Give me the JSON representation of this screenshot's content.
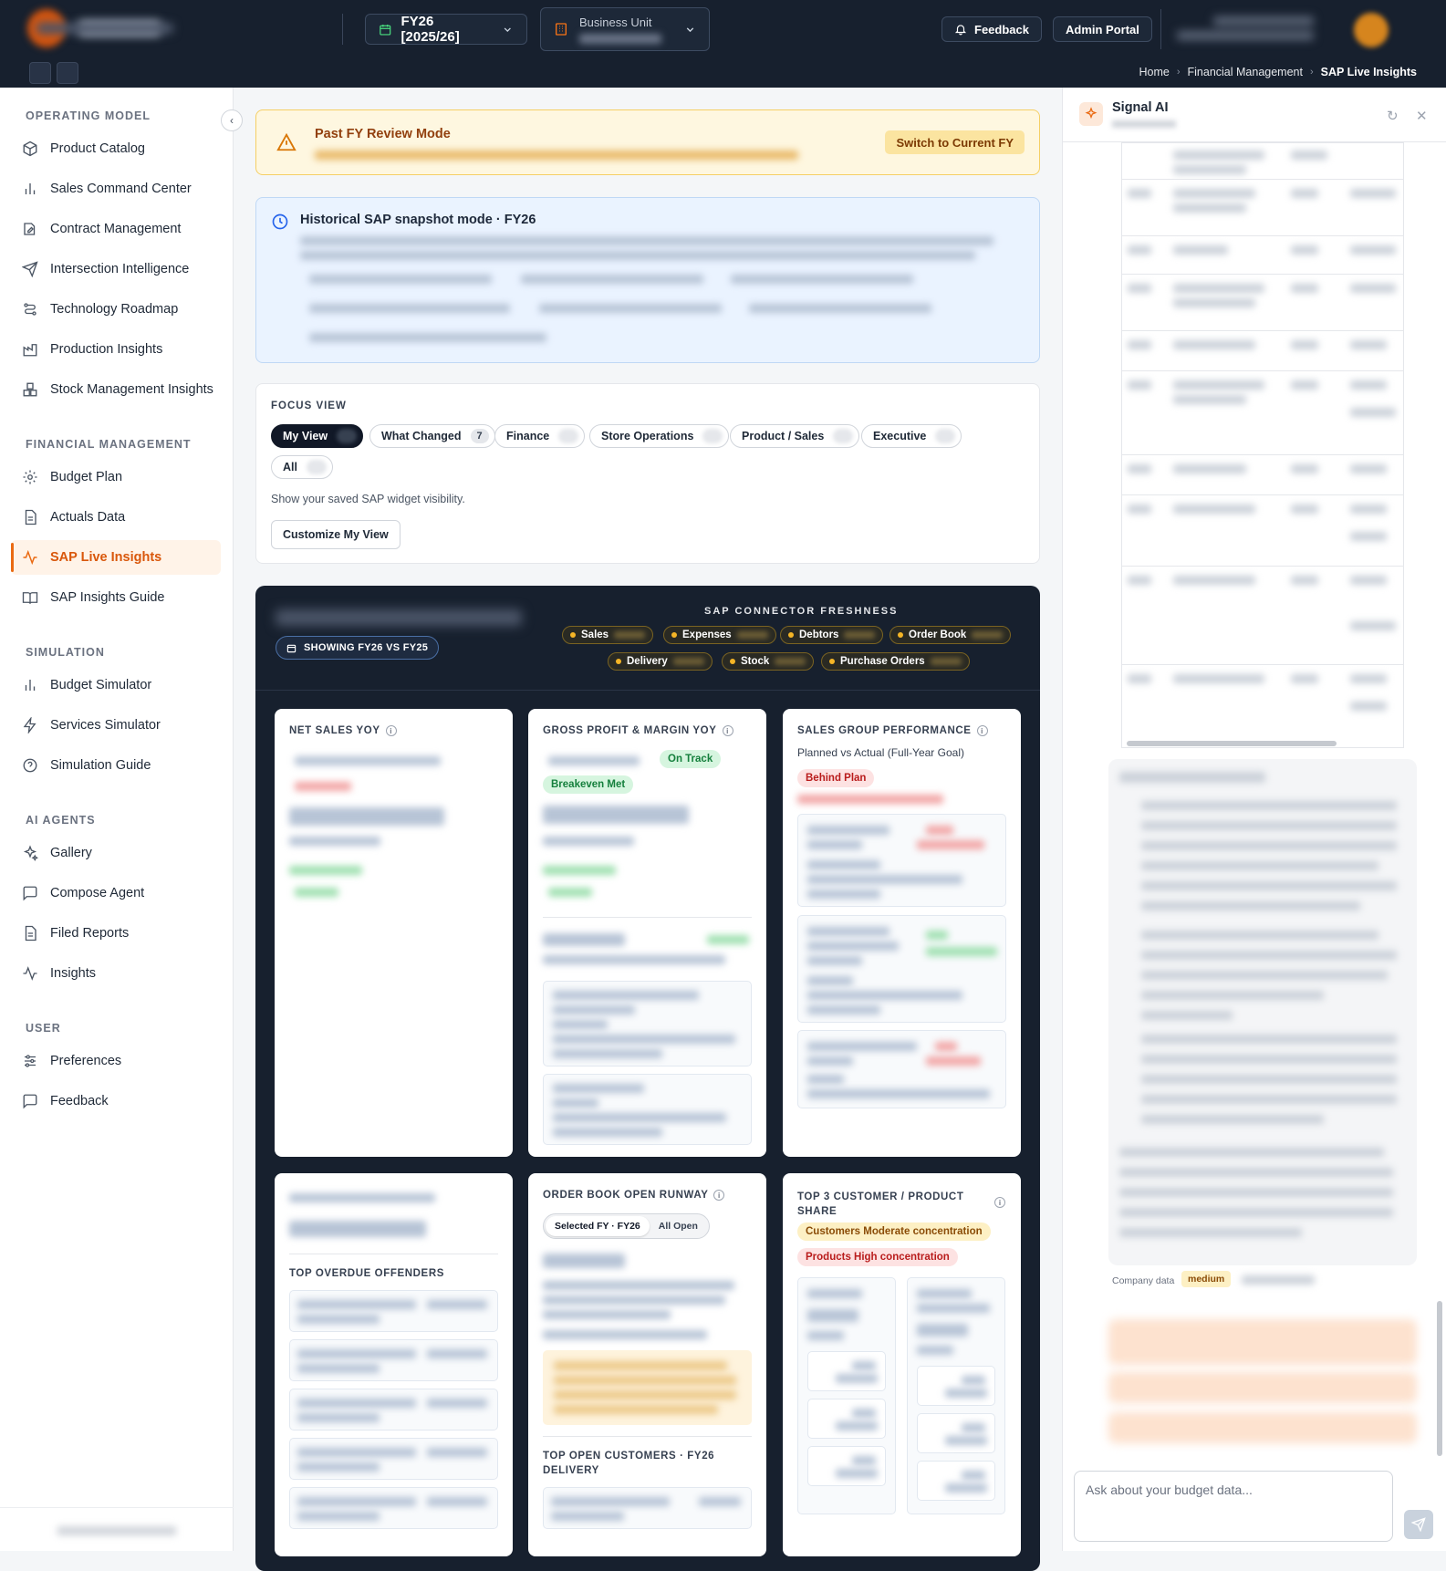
{
  "topbar": {
    "fy_label": "FY26 [2025/26]",
    "business_unit_label": "Business Unit",
    "feedback_label": "Feedback",
    "admin_label": "Admin Portal"
  },
  "breadcrumb": {
    "home": "Home",
    "section": "Financial Management",
    "current": "SAP Live Insights"
  },
  "sidebar": {
    "sections": [
      {
        "title": "OPERATING MODEL",
        "items": [
          {
            "label": "Product Catalog",
            "icon": "box-icon"
          },
          {
            "label": "Sales Command Center",
            "icon": "bar-chart-icon"
          },
          {
            "label": "Contract Management",
            "icon": "edit-document-icon"
          },
          {
            "label": "Intersection Intelligence",
            "icon": "send-icon"
          },
          {
            "label": "Technology Roadmap",
            "icon": "route-icon"
          },
          {
            "label": "Production Insights",
            "icon": "factory-icon"
          },
          {
            "label": "Stock Management Insights",
            "icon": "boxes-icon"
          }
        ]
      },
      {
        "title": "FINANCIAL MANAGEMENT",
        "items": [
          {
            "label": "Budget Plan",
            "icon": "gear-icon"
          },
          {
            "label": "Actuals Data",
            "icon": "document-icon"
          },
          {
            "label": "SAP Live Insights",
            "icon": "activity-icon",
            "active": true
          },
          {
            "label": "SAP Insights Guide",
            "icon": "book-icon"
          }
        ]
      },
      {
        "title": "SIMULATION",
        "items": [
          {
            "label": "Budget Simulator",
            "icon": "bar-chart-icon"
          },
          {
            "label": "Services Simulator",
            "icon": "lightning-icon"
          },
          {
            "label": "Simulation Guide",
            "icon": "help-circle-icon"
          }
        ]
      },
      {
        "title": "AI AGENTS",
        "items": [
          {
            "label": "Gallery",
            "icon": "sparkles-icon"
          },
          {
            "label": "Compose Agent",
            "icon": "message-square-icon"
          },
          {
            "label": "Filed Reports",
            "icon": "document-icon"
          },
          {
            "label": "Insights",
            "icon": "activity-icon"
          }
        ]
      },
      {
        "title": "USER",
        "items": [
          {
            "label": "Preferences",
            "icon": "sliders-icon"
          },
          {
            "label": "Feedback",
            "icon": "message-square-icon"
          }
        ]
      }
    ]
  },
  "warning": {
    "title": "Past FY Review Mode",
    "button": "Switch to Current FY"
  },
  "historical": {
    "title": "Historical SAP snapshot mode · FY26"
  },
  "focus": {
    "heading": "FOCUS VIEW",
    "chips": [
      {
        "label": "My View",
        "count": ""
      },
      {
        "label": "What Changed",
        "count": "7"
      },
      {
        "label": "Finance",
        "count": ""
      },
      {
        "label": "Store Operations",
        "count": ""
      },
      {
        "label": "Product / Sales",
        "count": ""
      },
      {
        "label": "Executive",
        "count": ""
      },
      {
        "label": "All",
        "count": ""
      }
    ],
    "help": "Show your saved SAP widget visibility.",
    "customize": "Customize My View"
  },
  "dashboard": {
    "showing": "SHOWING FY26 VS FY25",
    "freshness_title": "SAP CONNECTOR FRESHNESS",
    "freshness": [
      "Sales",
      "Expenses",
      "Debtors",
      "Order Book",
      "Delivery",
      "Stock",
      "Purchase Orders"
    ],
    "cards": {
      "net_sales": {
        "title": "NET SALES YOY"
      },
      "gross_profit": {
        "title": "GROSS PROFIT & MARGIN YOY",
        "badge1": "On Track",
        "badge2": "Breakeven Met"
      },
      "sales_group": {
        "title": "SALES GROUP PERFORMANCE",
        "subtitle": "Planned vs Actual (Full-Year Goal)",
        "badge": "Behind Plan"
      },
      "debtors": {
        "subheading": "TOP OVERDUE OFFENDERS"
      },
      "order_book": {
        "title": "ORDER BOOK OPEN RUNWAY",
        "seg_selected": "Selected FY · FY26",
        "seg_all": "All Open",
        "subheading": "TOP OPEN CUSTOMERS · FY26 DELIVERY"
      },
      "top3": {
        "title": "TOP 3 CUSTOMER / PRODUCT SHARE",
        "badge1": "Customers Moderate concentration",
        "badge2": "Products High concentration"
      }
    }
  },
  "assistant": {
    "name": "Signal AI",
    "company_label": "Company data",
    "confidence": "medium",
    "input_placeholder": "Ask about your budget data..."
  },
  "colors": {
    "accent": "#ea6a12",
    "topbar": "#17202e",
    "dashboard": "#17202e",
    "success": "#15803d",
    "danger": "#b91c1c"
  }
}
